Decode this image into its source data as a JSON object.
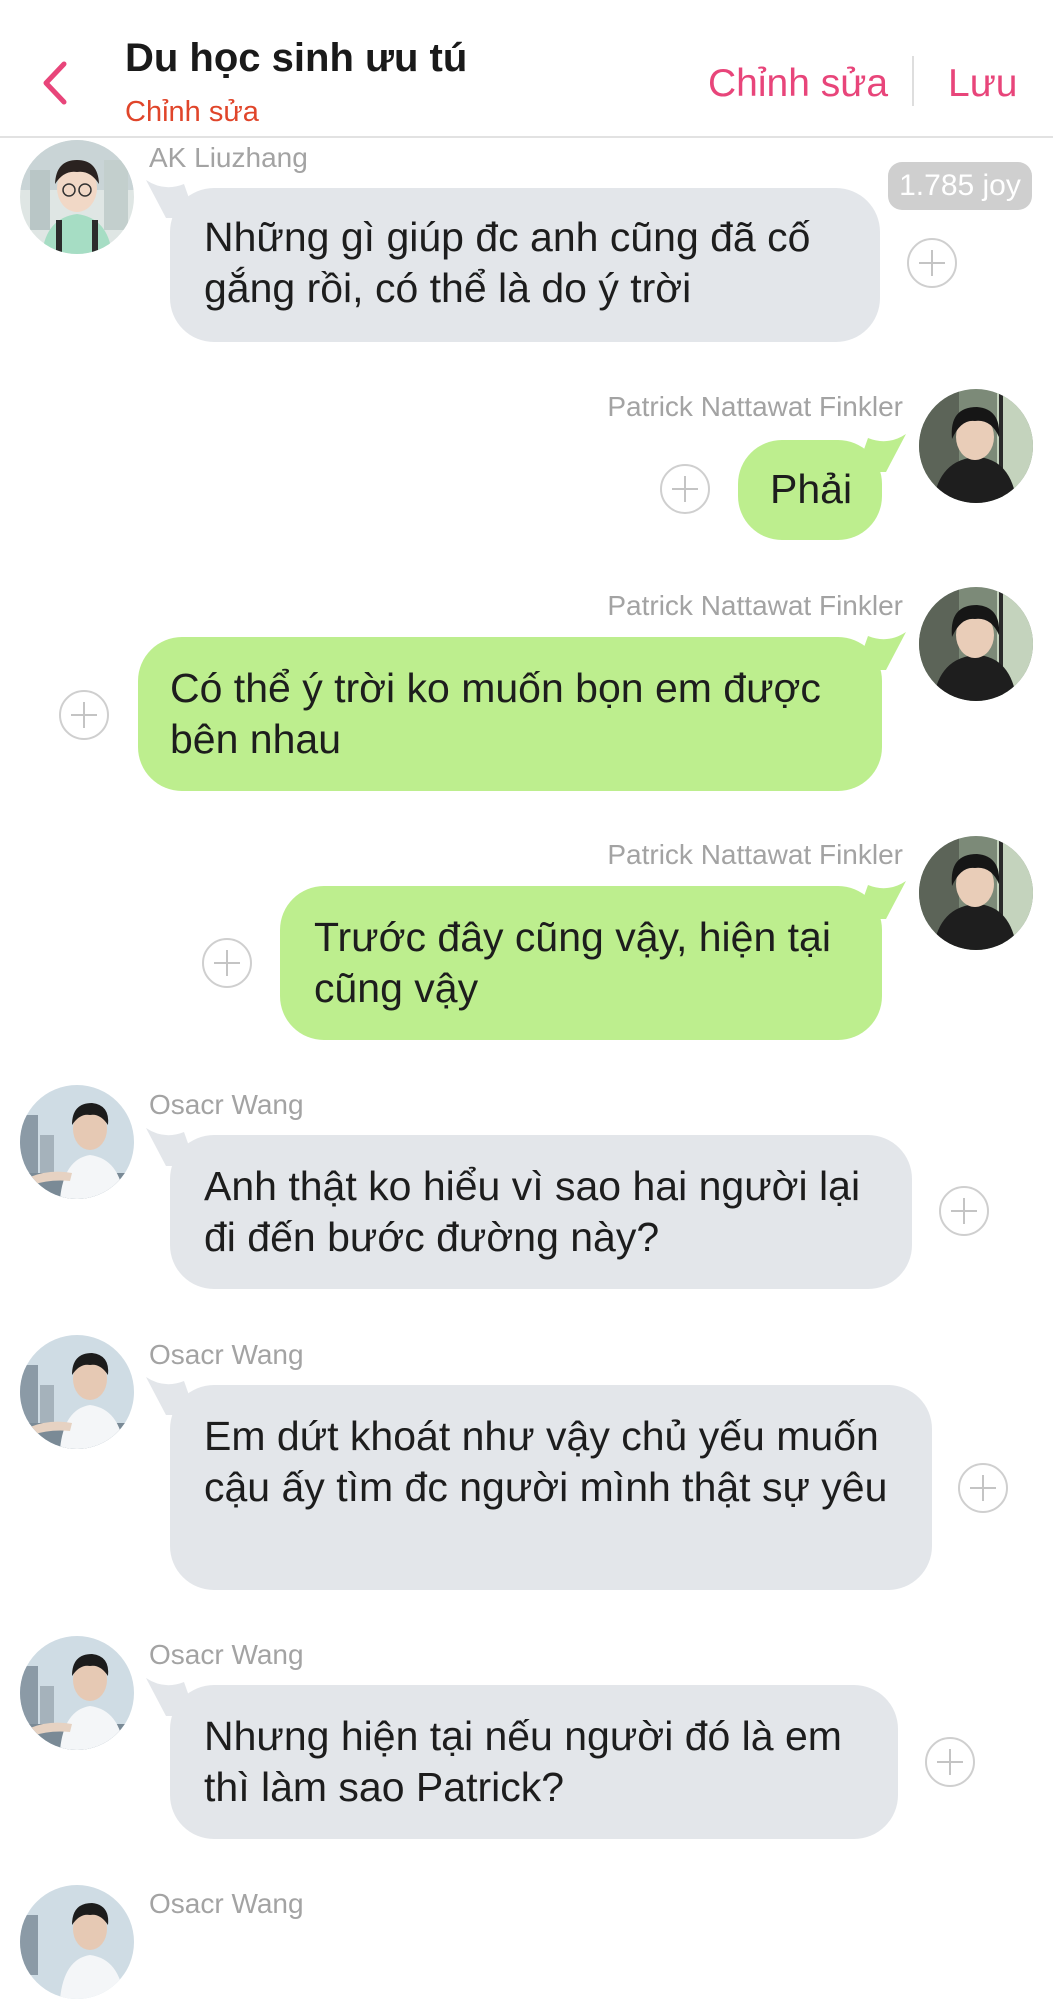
{
  "header": {
    "title": "Du học sinh ưu tú",
    "subtitle": "Chỉnh sửa",
    "edit_label": "Chỉnh sửa",
    "save_label": "Lưu"
  },
  "messages": [
    {
      "sender": "AK Liuzhang",
      "text": "Những gì giúp đc anh cũng đã cố gắng rồi, có thể là do ý trời",
      "side": "left"
    },
    {
      "sender": "Patrick Nattawat Finkler",
      "text": "Phải",
      "side": "right"
    },
    {
      "sender": "Patrick Nattawat Finkler",
      "text": "Có thể ý trời ko muốn bọn em được bên nhau",
      "side": "right"
    },
    {
      "sender": "Patrick Nattawat Finkler",
      "text": "Trước đây cũng vậy, hiện tại cũng vậy",
      "side": "right"
    },
    {
      "sender": "Osacr Wang",
      "text": "Anh thật ko hiểu vì sao hai người lại đi đến bước đường này?",
      "side": "left"
    },
    {
      "sender": "Osacr Wang",
      "text": "Em dứt khoát như vậy chủ yếu muốn cậu ấy tìm đc người mình thật sự yêu",
      "side": "left"
    },
    {
      "sender": "Osacr Wang",
      "text": "Nhưng hiện tại nếu người đó là em thì làm sao Patrick?",
      "side": "left"
    },
    {
      "sender": "Osacr Wang",
      "text": "",
      "side": "left"
    }
  ],
  "joy_badge": "1.785 joy",
  "colors": {
    "accent": "#e8457a",
    "subtitle": "#e0452a",
    "incoming_bubble": "#e3e6ea",
    "outgoing_bubble": "#bdee8e"
  }
}
